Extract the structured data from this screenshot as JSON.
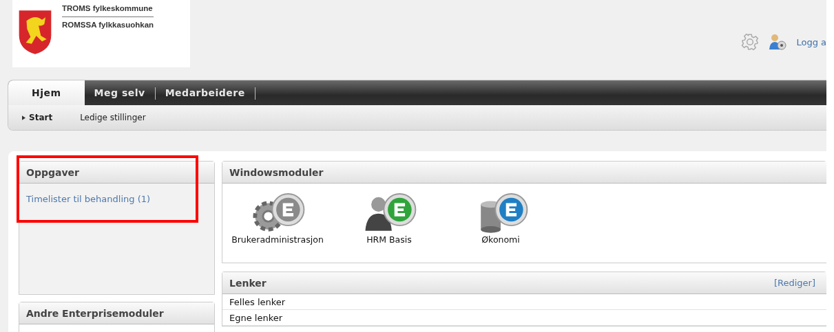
{
  "header": {
    "org_lines": [
      "TROMS fylkeskommune",
      "ROMSSA fylkkasuohkan"
    ],
    "logout_link": "Logg a"
  },
  "tabs": [
    {
      "label": "Hjem",
      "selected": true
    },
    {
      "label": "Meg selv",
      "selected": false
    },
    {
      "label": "Medarbeidere",
      "selected": false
    }
  ],
  "subnav": [
    {
      "label": "Start",
      "selected": true
    },
    {
      "label": "Ledige stillinger",
      "selected": false
    }
  ],
  "sidebar_panels": [
    {
      "title": "Oppgaver",
      "highlighted": true,
      "links": [
        "Timelister til behandling (1)"
      ]
    },
    {
      "title": "Andre Enterprisemoduler",
      "highlighted": false
    }
  ],
  "windowsmoduler": {
    "title": "Windowsmoduler",
    "modules": [
      {
        "label": "Brukeradministrasjon",
        "kind": "gear",
        "color": "#8a8a8a"
      },
      {
        "label": "HRM Basis",
        "kind": "person",
        "color": "#2fa43a"
      },
      {
        "label": "Økonomi",
        "kind": "database",
        "color": "#1f7fc4"
      }
    ]
  },
  "lenker": {
    "title": "Lenker",
    "edit_link": "[Rediger]",
    "items": [
      "Felles lenker",
      "Egne lenker"
    ]
  }
}
